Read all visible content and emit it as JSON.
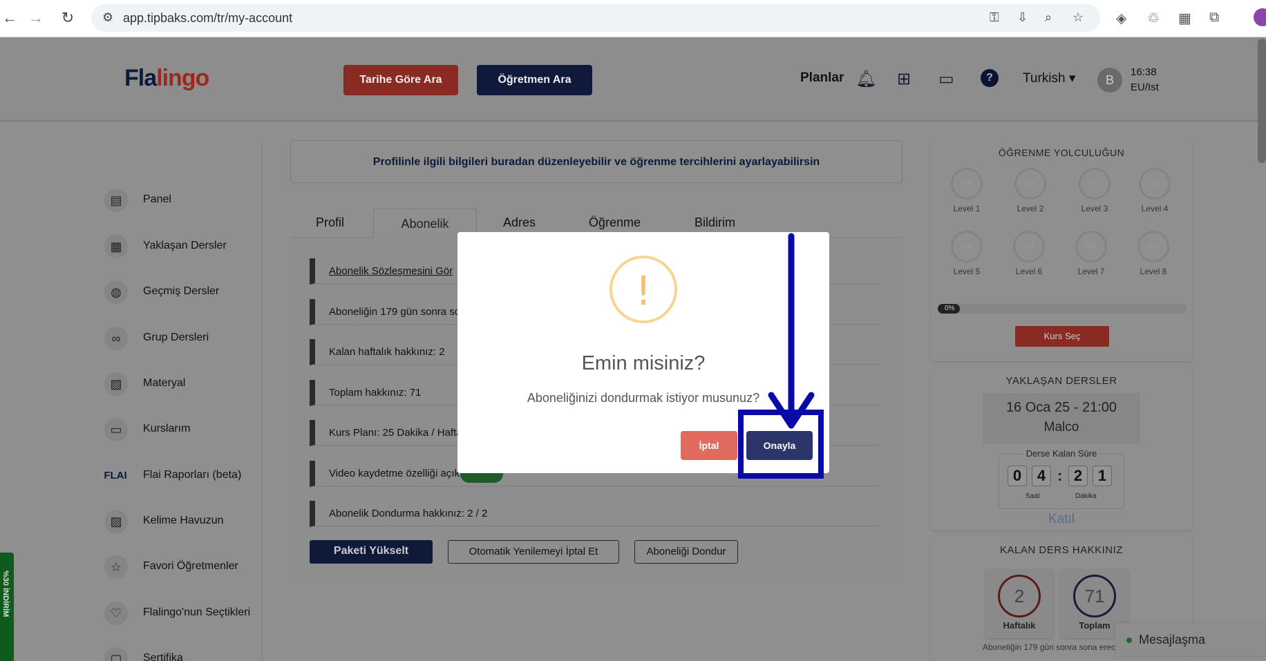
{
  "browser": {
    "url": "app.tipbaks.com/tr/my-account",
    "back_icon": "←",
    "forward_icon": "→",
    "reload_icon": "↻"
  },
  "header": {
    "logo_main": "Fla",
    "logo_accent": "lingo",
    "search_by_date": "Tarihe Göre Ara",
    "search_teacher": "Öğretmen Ara",
    "plans": "Planlar",
    "language": "Turkish ▾",
    "avatar_letter": "B",
    "time": "16:38",
    "timezone": "EU/Ist"
  },
  "sidebar": {
    "items": [
      {
        "label": "Panel",
        "icon": "▤"
      },
      {
        "label": "Yaklaşan Dersler",
        "icon": "▦"
      },
      {
        "label": "Geçmiş Dersler",
        "icon": "◍"
      },
      {
        "label": "Grup Dersleri",
        "icon": "∞"
      },
      {
        "label": "Materyal",
        "icon": "▧"
      },
      {
        "label": "Kurslarım",
        "icon": "▭"
      },
      {
        "label": "Flai Raporları (beta)",
        "icon": "FLAI"
      },
      {
        "label": "Kelime Havuzun",
        "icon": "▨"
      },
      {
        "label": "Favori Öğretmenler",
        "icon": "☆"
      },
      {
        "label": "Flalingo'nun Seçtikleri",
        "icon": "♡"
      },
      {
        "label": "Sertifika",
        "icon": "▢"
      }
    ]
  },
  "main": {
    "banner": "Profilinle ilgili bilgileri buradan düzenleyebilir ve öğrenme tercihlerini ayarlayabilirsin",
    "tabs": [
      "Profil",
      "Abonelik",
      "Adres",
      "Öğrenme",
      "Bildirim"
    ],
    "rows": [
      "Abonelik Sözleşmesini Gör",
      "Aboneliğin 179 gün sonra so",
      "Kalan haftalık hakkınız:  2",
      "Toplam hakkınız:  71",
      "Kurs Planı:  25 Dakika / Hafta",
      "Video kaydetme özelliği açık",
      "Abonelik Dondurma hakkınız:  2 / 2"
    ],
    "buttons": {
      "upgrade": "Paketi Yükselt",
      "cancel_auto_renew": "Otomatik Yenilemeyi İptal Et",
      "freeze": "Aboneliği Dondur"
    }
  },
  "journey": {
    "title": "ÖĞRENME YOLCULUĞUN",
    "levels": [
      {
        "label": "Level 1",
        "pct": "0%"
      },
      {
        "label": "Level 2",
        "pct": "0%"
      },
      {
        "label": "Level 3",
        "pct": "0%"
      },
      {
        "label": "Level 4",
        "pct": "0%"
      },
      {
        "label": "Level 5",
        "pct": "0%"
      },
      {
        "label": "Level 6",
        "pct": "0%"
      },
      {
        "label": "Level 7",
        "pct": "0%"
      },
      {
        "label": "Level 8",
        "pct": "0%"
      }
    ],
    "progress_label": "0%",
    "progress_value": 0,
    "select_course": "Kurs Seç"
  },
  "upcoming": {
    "title": "YAKLAŞAN DERSLER",
    "date": "16 Oca 25 - 21:00",
    "teacher": "Malco",
    "countdown_title": "Derse Kalan Süre",
    "digits": [
      "0",
      "4",
      "2",
      "1"
    ],
    "unit_hours": "Saat",
    "unit_minutes": "Dakika",
    "join": "Katıl"
  },
  "quota": {
    "title": "KALAN DERS HAKKINIZ",
    "weekly_value": "2",
    "weekly_label": "Haftalık",
    "total_value": "71",
    "total_label": "Toplam",
    "note": "Aboneliğin 179 gün sonra sona erec"
  },
  "chat": {
    "label": "Mesajlaşma"
  },
  "discount_tab": {
    "label": "%30 İNDİRİM"
  },
  "modal": {
    "icon": "!",
    "title": "Emin misiniz?",
    "text": "Aboneliğinizi dondurmak istiyor musunuz?",
    "cancel": "İptal",
    "confirm": "Onayla"
  },
  "colors": {
    "annotation": "#0a0ba6",
    "confirm": "#2b3569",
    "cancel": "#e06a5e",
    "warning": "#f8d48f"
  }
}
